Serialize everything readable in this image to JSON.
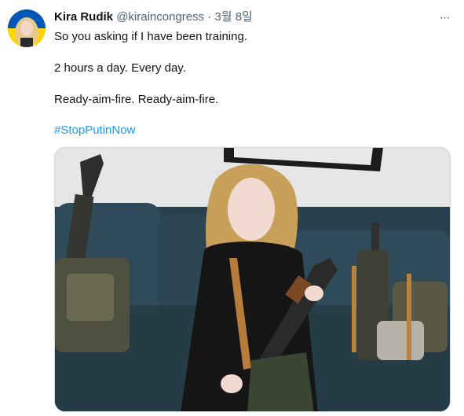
{
  "tweet": {
    "author_name": "Kira Rudik",
    "handle": "@kiraincongress",
    "separator": "·",
    "date": "3월 8일",
    "more_glyph": "···",
    "lines": [
      "So you asking if I have been training.",
      "2 hours a day. Every day.",
      "Ready-aim-fire. Ready-aim-fire."
    ],
    "hashtag": "#StopPutinNow"
  },
  "colors": {
    "link": "#1d9bf0",
    "secondary_text": "#536471",
    "primary_text": "#0f1419"
  },
  "icons": {
    "more": "more-horizontal-icon"
  }
}
